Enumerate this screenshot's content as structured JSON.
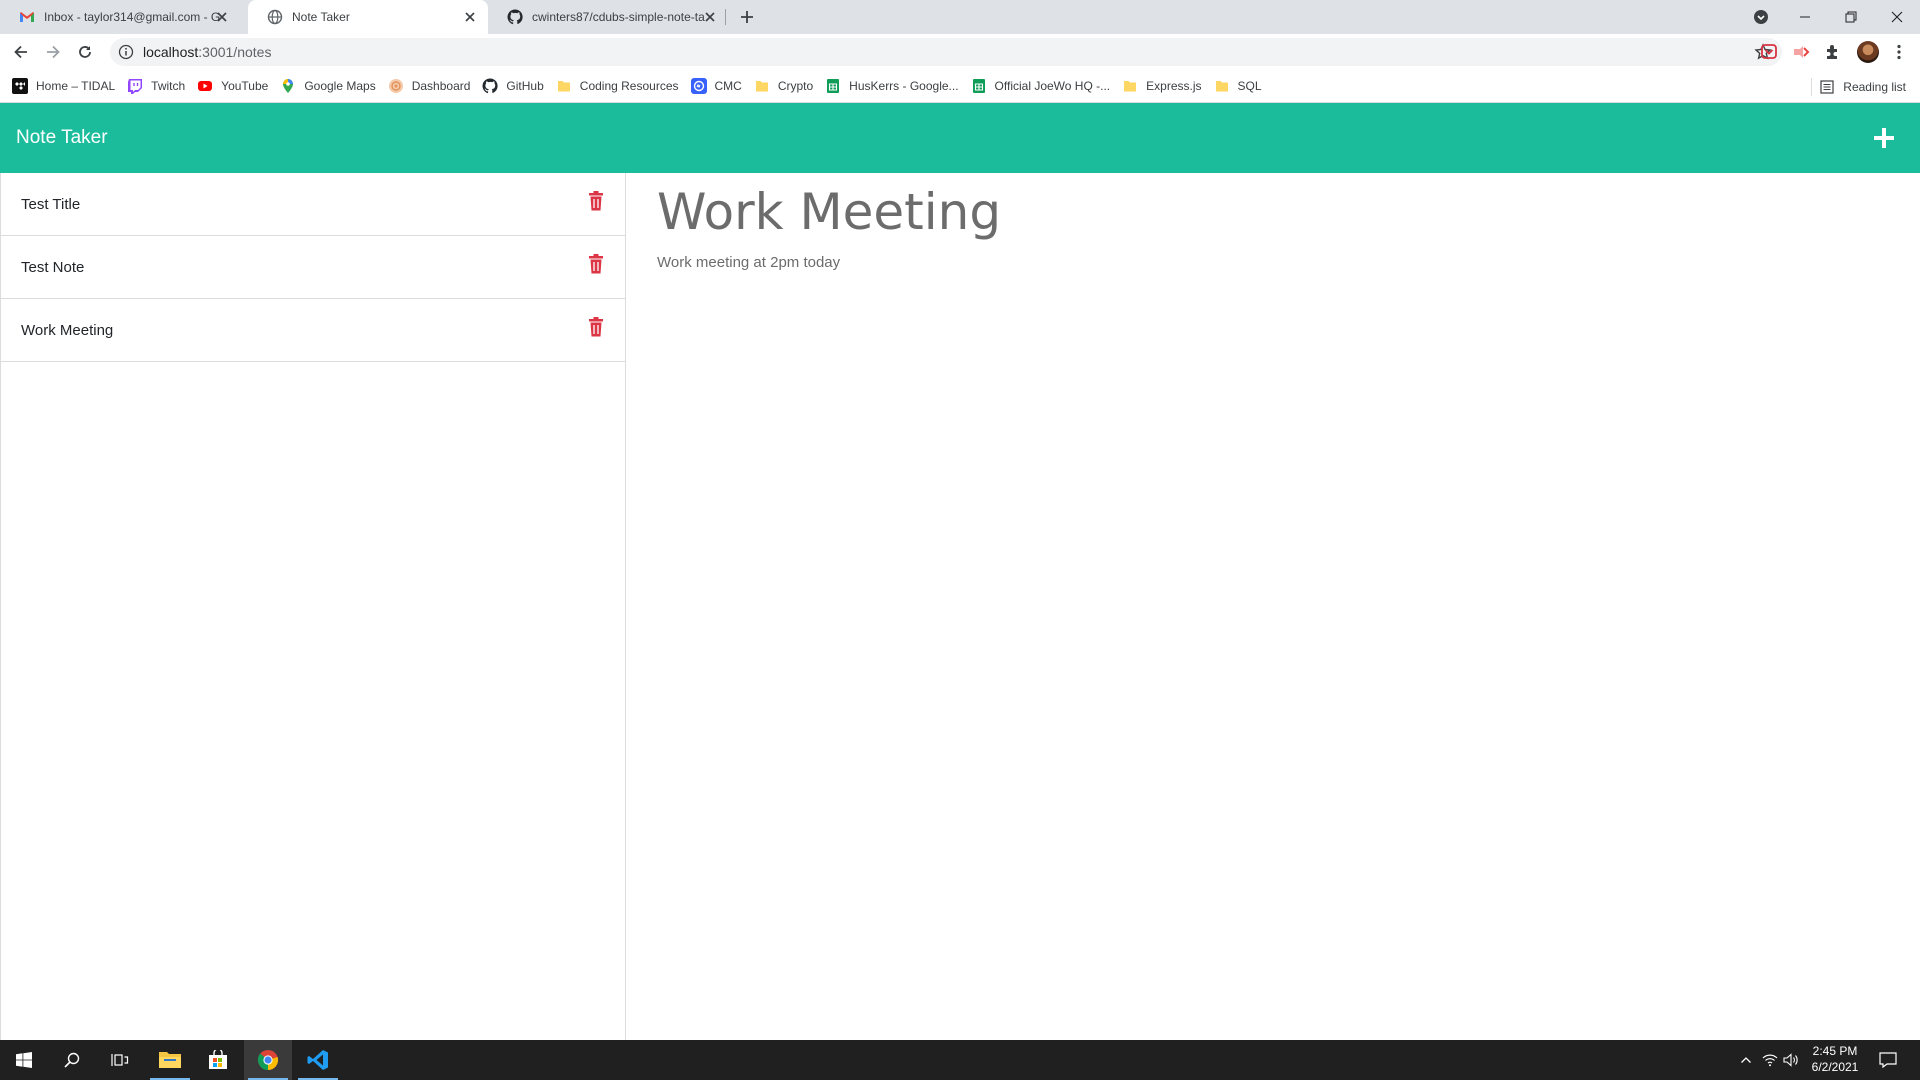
{
  "browser": {
    "tabs": [
      {
        "title": "Inbox - taylor314@gmail.com - G",
        "icon": "gmail-icon",
        "active": false
      },
      {
        "title": "Note Taker",
        "icon": "globe-icon",
        "active": true
      },
      {
        "title": "cwinters87/cdubs-simple-note-ta",
        "icon": "github-icon",
        "active": false
      }
    ],
    "address": {
      "host": "localhost",
      "rest": ":3001/notes"
    },
    "bookmarks": [
      {
        "label": "Home – TIDAL",
        "icon": "tidal-icon"
      },
      {
        "label": "Twitch",
        "icon": "twitch-icon"
      },
      {
        "label": "YouTube",
        "icon": "youtube-icon"
      },
      {
        "label": "Google Maps",
        "icon": "maps-pin-icon"
      },
      {
        "label": "Dashboard",
        "icon": "dashboard-icon"
      },
      {
        "label": "GitHub",
        "icon": "github-icon"
      },
      {
        "label": "Coding Resources",
        "icon": "folder-icon"
      },
      {
        "label": "CMC",
        "icon": "cmc-icon"
      },
      {
        "label": "Crypto",
        "icon": "folder-icon"
      },
      {
        "label": "HusKerrs - Google...",
        "icon": "sheets-icon"
      },
      {
        "label": "Official JoeWo HQ -...",
        "icon": "sheets-icon"
      },
      {
        "label": "Express.js",
        "icon": "folder-icon"
      },
      {
        "label": "SQL",
        "icon": "folder-icon"
      }
    ],
    "reading_list": "Reading list"
  },
  "app": {
    "brand": "Note Taker",
    "notes": [
      {
        "title": "Test Title"
      },
      {
        "title": "Test Note"
      },
      {
        "title": "Work Meeting"
      }
    ],
    "active_note": {
      "title": "Work Meeting",
      "text": "Work meeting at 2pm today"
    },
    "colors": {
      "navbar": "#1abc9c",
      "trash": "#dc3545"
    }
  },
  "taskbar": {
    "time": "2:45 PM",
    "date": "6/2/2021"
  }
}
